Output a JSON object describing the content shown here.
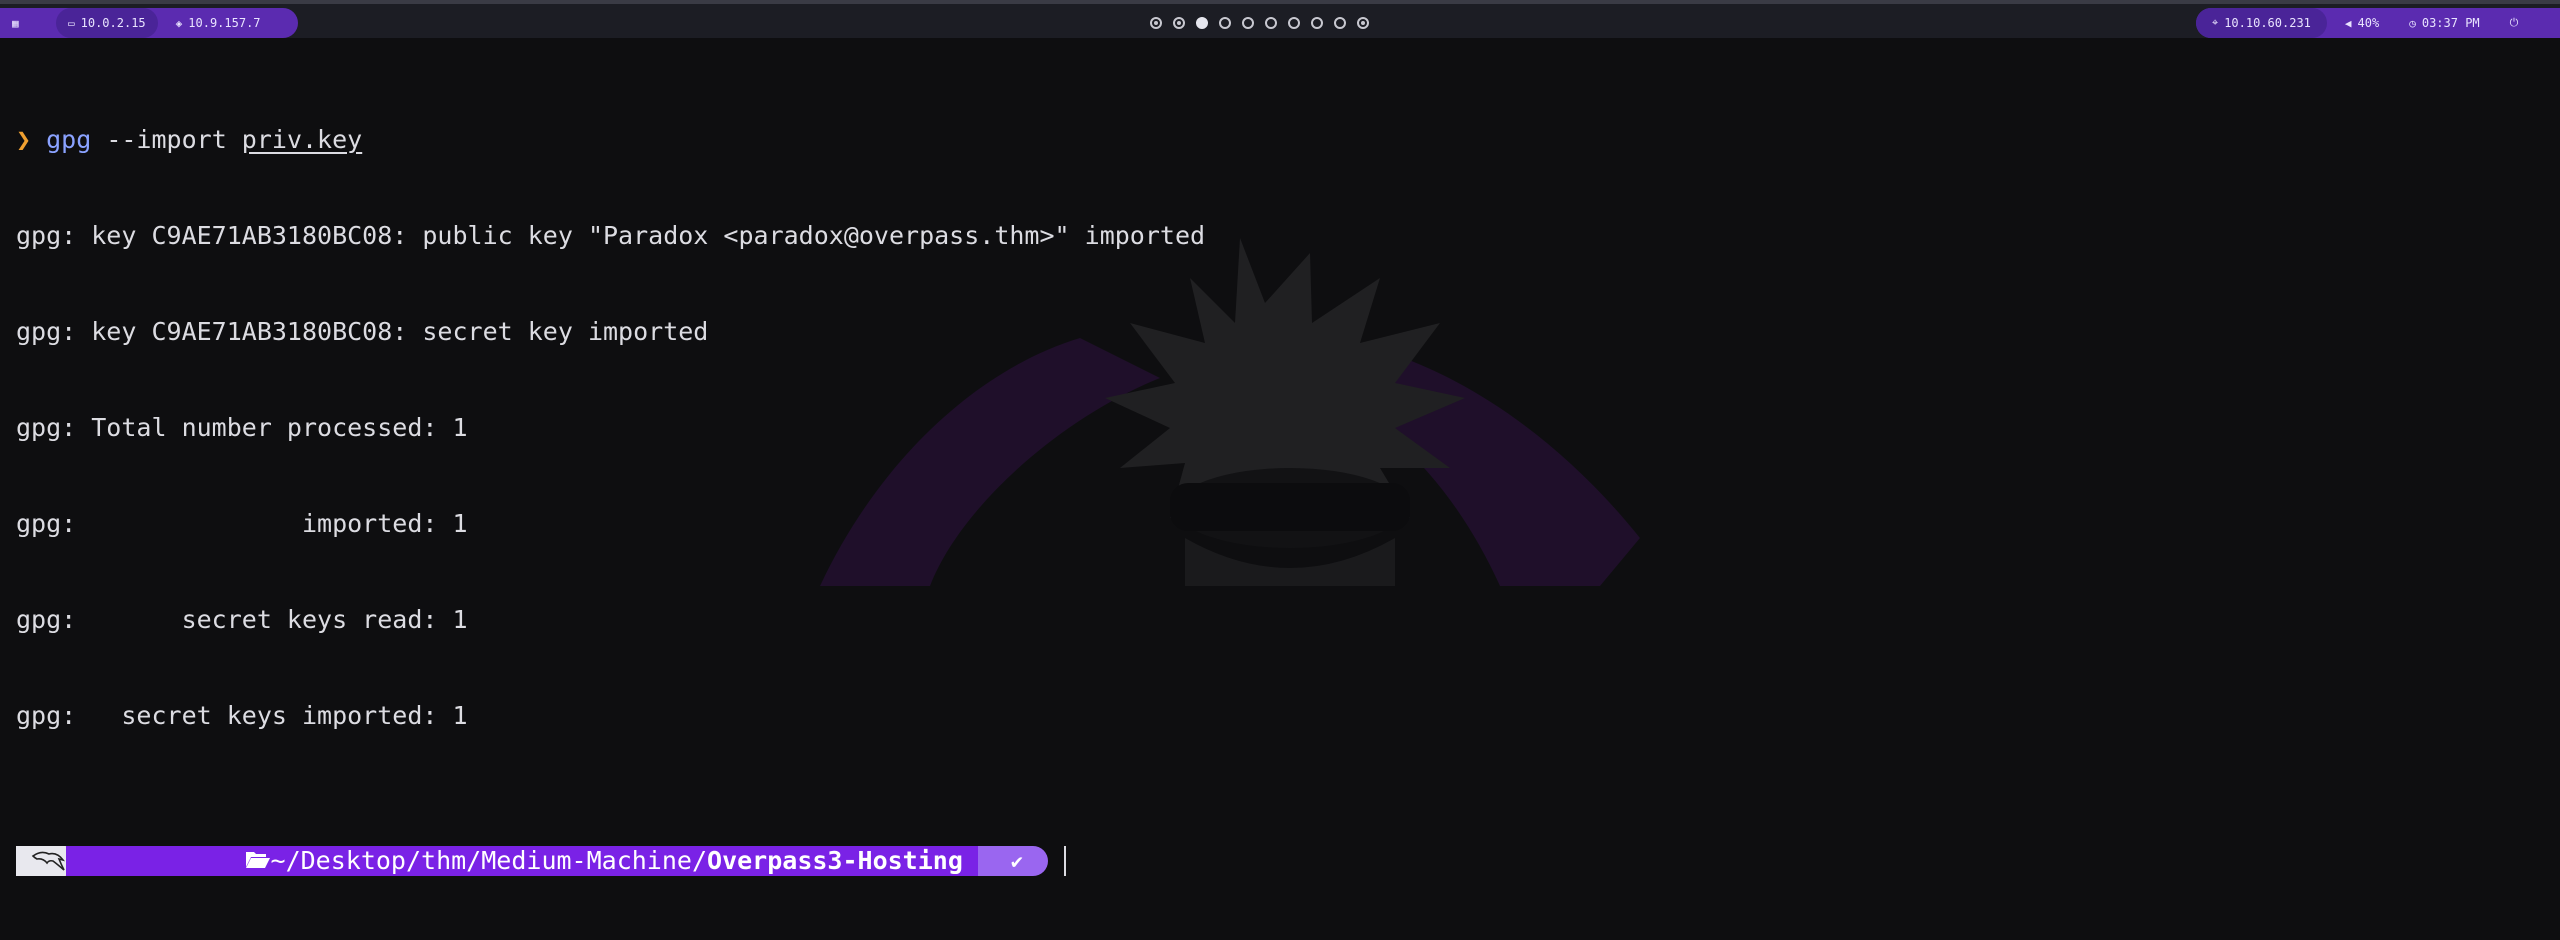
{
  "topbar": {
    "menu_icon": "grid-icon",
    "left": [
      {
        "icon": "monitor-icon",
        "label": "10.0.2.15"
      },
      {
        "icon": "shield-icon",
        "label": "10.9.157.7"
      }
    ],
    "workspaces": {
      "count": 10,
      "active_index": 2
    },
    "right": [
      {
        "icon": "target-icon",
        "label": "10.10.60.231"
      },
      {
        "icon": "speaker-icon",
        "label": "40%"
      },
      {
        "icon": "clock-icon",
        "label": "03:37 PM"
      }
    ],
    "power_icon": "power-icon"
  },
  "terminal": {
    "prompt_arrow": "❯",
    "command_name": "gpg",
    "command_args": " --import ",
    "command_file": "priv.key",
    "output": [
      "gpg: key C9AE71AB3180BC08: public key \"Paradox <paradox@overpass.thm>\" imported",
      "gpg: key C9AE71AB3180BC08: secret key imported",
      "gpg: Total number processed: 1",
      "gpg:               imported: 1",
      "gpg:       secret keys read: 1",
      "gpg:   secret keys imported: 1"
    ],
    "prompt": {
      "logo_icon": "kali-dragon-icon",
      "folder_icon": "folder-open-icon",
      "path_prefix": "~/Desktop/thm/Medium-Machine/",
      "path_current": "Overpass3-Hosting",
      "status_icon": "check-icon",
      "status_glyph": "✔"
    }
  },
  "colors": {
    "accent": "#5b2bb0",
    "path_bg": "#7a22e6",
    "status_bg": "#9a66f0",
    "prompt_arrow": "#f0a030",
    "command": "#8aa2ff"
  }
}
